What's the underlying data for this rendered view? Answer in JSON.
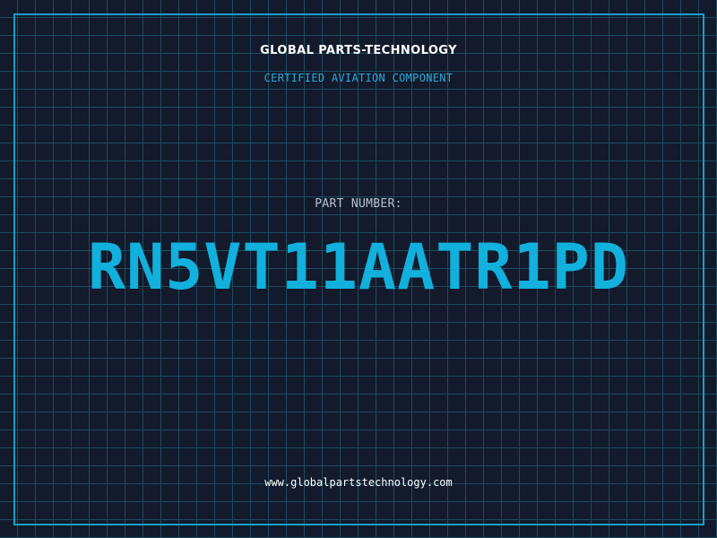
{
  "header": {
    "company": "GLOBAL PARTS-TECHNOLOGY",
    "subtitle": "CERTIFIED AVIATION COMPONENT"
  },
  "part": {
    "label": "PART NUMBER:",
    "number": "RN5VT11AATR1PD"
  },
  "footer": {
    "website": "www.globalpartstechnology.com"
  },
  "colors": {
    "background": "#121a2c",
    "grid": "#1a4c5e",
    "frame": "#1c9fc6",
    "accent": "#12b0dc",
    "label": "#b8c0cc",
    "text": "#ffffff"
  }
}
